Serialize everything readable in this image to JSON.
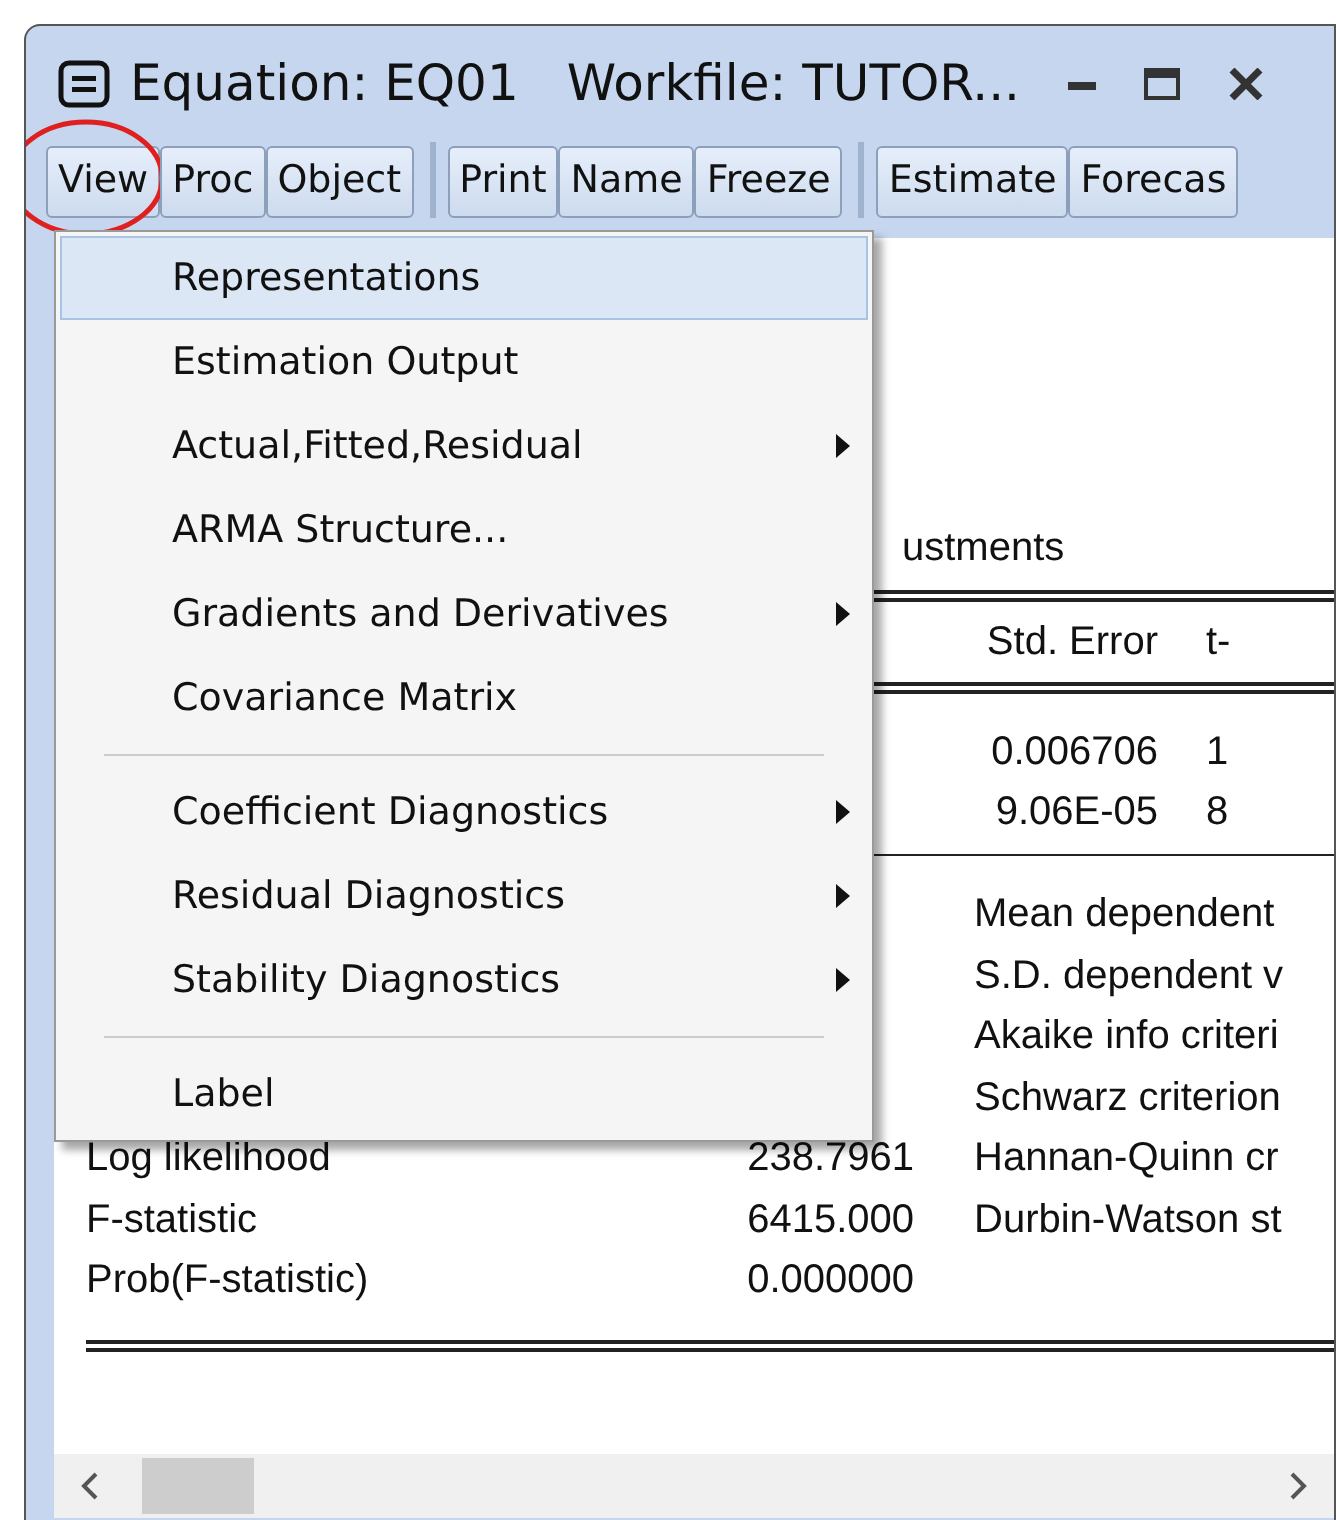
{
  "window": {
    "title": "Equation: EQ01",
    "workfile": "Workfile: TUTOR..."
  },
  "toolbar": [
    [
      {
        "label": "View",
        "circled": true
      },
      {
        "label": "Proc",
        "circled": false
      },
      {
        "label": "Object",
        "circled": false
      }
    ],
    [
      {
        "label": "Print",
        "circled": false
      },
      {
        "label": "Name",
        "circled": false
      },
      {
        "label": "Freeze",
        "circled": false
      }
    ],
    [
      {
        "label": "Estimate",
        "circled": false
      },
      {
        "label": "Forecas",
        "circled": false
      }
    ]
  ],
  "output": {
    "note": "ustments",
    "header": [
      "Std. Error",
      "t-"
    ],
    "coef_rows": [
      [
        "0.006706",
        "1"
      ],
      [
        "9.06E-05",
        "8"
      ]
    ],
    "stats": [
      {
        "right": "Mean dependent"
      },
      {
        "right": "S.D. dependent v"
      },
      {
        "right": "Akaike info criteri"
      },
      {
        "right": "Schwarz criterion"
      },
      {
        "label": "Log likelihood",
        "value": "238.7961",
        "right": "Hannan-Quinn cr"
      },
      {
        "label": "F-statistic",
        "value": "6415.000",
        "right": "Durbin-Watson st"
      },
      {
        "label": "Prob(F-statistic)",
        "value": "0.000000"
      }
    ]
  },
  "menu": [
    {
      "kind": "item",
      "label": "Representations",
      "selected": true,
      "submenu": false
    },
    {
      "kind": "item",
      "label": "Estimation Output",
      "selected": false,
      "submenu": false
    },
    {
      "kind": "item",
      "label": "Actual,Fitted,Residual",
      "selected": false,
      "submenu": true
    },
    {
      "kind": "item",
      "label": "ARMA Structure...",
      "selected": false,
      "submenu": false
    },
    {
      "kind": "item",
      "label": "Gradients and Derivatives",
      "selected": false,
      "submenu": true
    },
    {
      "kind": "item",
      "label": "Covariance Matrix",
      "selected": false,
      "submenu": false
    },
    {
      "kind": "separator"
    },
    {
      "kind": "item",
      "label": "Coefficient Diagnostics",
      "selected": false,
      "submenu": true
    },
    {
      "kind": "item",
      "label": "Residual Diagnostics",
      "selected": false,
      "submenu": true
    },
    {
      "kind": "item",
      "label": "Stability Diagnostics",
      "selected": false,
      "submenu": true
    },
    {
      "kind": "separator"
    },
    {
      "kind": "item",
      "label": "Label",
      "selected": false,
      "submenu": false
    }
  ]
}
